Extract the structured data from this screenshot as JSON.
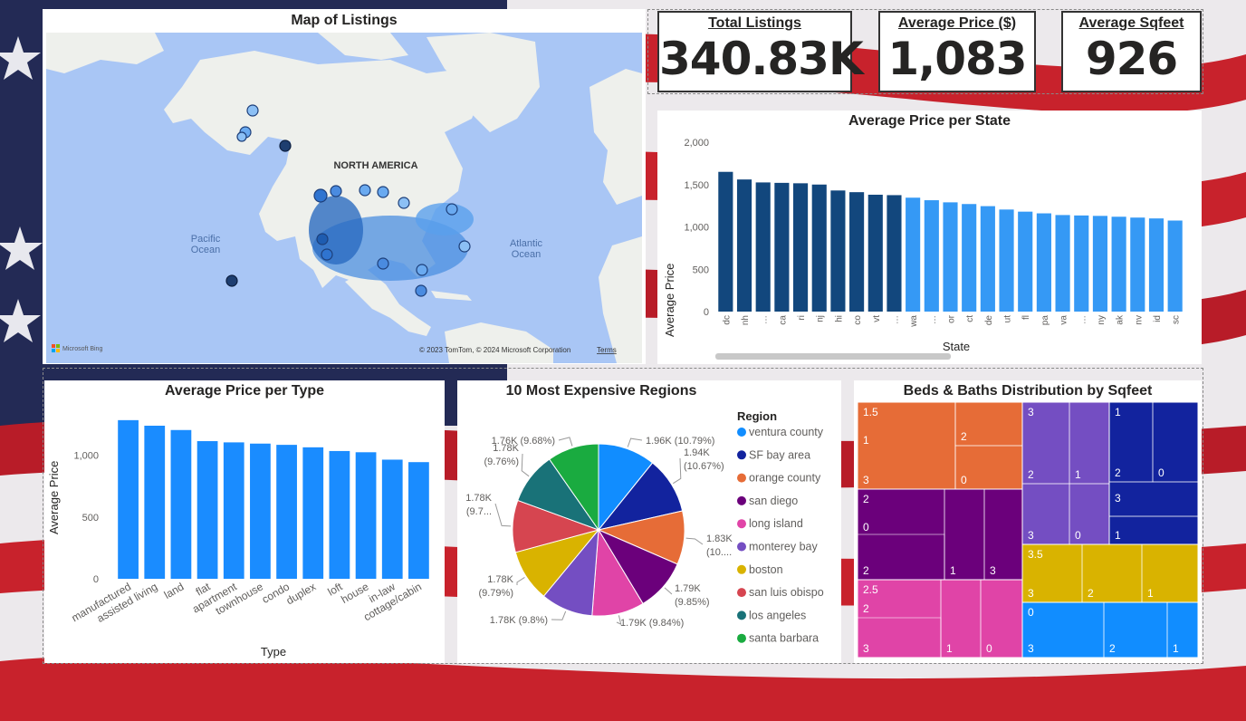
{
  "colors": {
    "dark_blue": "#12477d",
    "light_blue": "#3599f5",
    "type_blue": "#1a8cff",
    "flag_red": "#c8222c",
    "flag_navy": "#1e2448"
  },
  "map": {
    "title": "Map of Listings",
    "labels": {
      "continent": "NORTH AMERICA",
      "pacific_1": "Pacific",
      "pacific_2": "Ocean",
      "atlantic_1": "Atlantic",
      "atlantic_2": "Ocean"
    },
    "attribution": "© 2023 TomTom, © 2024 Microsoft Corporation",
    "terms": "Terms",
    "bing_logo": "Microsoft Bing"
  },
  "kpis": [
    {
      "label": "Total Listings",
      "value": "340.83K"
    },
    {
      "label": "Average Price ($)",
      "value": "1,083"
    },
    {
      "label": "Average Sqfeet",
      "value": "926"
    }
  ],
  "state_chart": {
    "title": "Average Price per State",
    "xlabel": "State",
    "ylabel": "Average Price",
    "chart_data": {
      "type": "bar",
      "categories": [
        "dc",
        "nh",
        "…",
        "ca",
        "ri",
        "nj",
        "hi",
        "co",
        "vt",
        "…",
        "wa",
        "…",
        "or",
        "ct",
        "de",
        "ut",
        "fl",
        "pa",
        "va",
        "…",
        "ny",
        "ak",
        "nv",
        "id",
        "sc"
      ],
      "values": [
        1650,
        1560,
        1525,
        1520,
        1515,
        1500,
        1430,
        1410,
        1380,
        1375,
        1345,
        1315,
        1290,
        1270,
        1245,
        1205,
        1180,
        1160,
        1140,
        1135,
        1130,
        1120,
        1110,
        1100,
        1075
      ],
      "dark_count": 10,
      "ylim": [
        0,
        2000
      ],
      "yticks": [
        0,
        500,
        1000,
        1500,
        2000
      ],
      "ytick_labels": [
        "0",
        "500",
        "1,000",
        "1,500",
        "2,000"
      ]
    }
  },
  "type_chart": {
    "title": "Average Price per Type",
    "xlabel": "Type",
    "ylabel": "Average Price",
    "chart_data": {
      "type": "bar",
      "categories": [
        "manufactured",
        "assisted living",
        "land",
        "flat",
        "apartment",
        "townhouse",
        "condo",
        "duplex",
        "loft",
        "house",
        "in-law",
        "cottage/cabin"
      ],
      "values": [
        1285,
        1240,
        1205,
        1115,
        1105,
        1095,
        1085,
        1065,
        1035,
        1025,
        965,
        945
      ],
      "ylim": [
        0,
        1350
      ],
      "yticks": [
        0,
        500,
        1000
      ],
      "ytick_labels": [
        "0",
        "500",
        "1,000"
      ]
    }
  },
  "pie_chart": {
    "title": "10 Most Expensive Regions",
    "legend_title": "Region",
    "chart_data": {
      "type": "pie",
      "slices": [
        {
          "name": "ventura county",
          "value": 1.96,
          "percent": 10.79,
          "color": "#118dff",
          "label_lines": [
            "1.96K (10.79%)"
          ]
        },
        {
          "name": "SF bay area",
          "value": 1.94,
          "percent": 10.67,
          "color": "#12239e",
          "label_lines": [
            "1.94K",
            "(10.67%)"
          ]
        },
        {
          "name": "orange county",
          "value": 1.83,
          "percent": 10.07,
          "color": "#e66c37",
          "label_lines": [
            "1.83K",
            "(10...."
          ]
        },
        {
          "name": "san diego",
          "value": 1.79,
          "percent": 9.85,
          "color": "#6b007b",
          "label_lines": [
            "1.79K",
            "(9.85%)"
          ]
        },
        {
          "name": "long island",
          "value": 1.79,
          "percent": 9.84,
          "color": "#e044a7",
          "label_lines": [
            "1.79K (9.84%)"
          ]
        },
        {
          "name": "monterey bay",
          "value": 1.78,
          "percent": 9.8,
          "color": "#744ec2",
          "label_lines": [
            "1.78K (9.8%)"
          ]
        },
        {
          "name": "boston",
          "value": 1.78,
          "percent": 9.79,
          "color": "#d9b300",
          "label_lines": [
            "1.78K",
            "(9.79%)"
          ]
        },
        {
          "name": "san luis obispo",
          "value": 1.78,
          "percent": 9.77,
          "color": "#d64550",
          "label_lines": [
            "1.78K",
            "(9.7..."
          ]
        },
        {
          "name": "los angeles",
          "value": 1.78,
          "percent": 9.76,
          "color": "#197278",
          "label_lines": [
            "1.78K",
            "(9.76%)"
          ]
        },
        {
          "name": "santa barbara",
          "value": 1.76,
          "percent": 9.68,
          "color": "#1aab40",
          "label_lines": [
            "1.76K (9.68%)"
          ]
        }
      ]
    }
  },
  "treemap": {
    "title": "Beds & Baths Distribution by Sqfeet",
    "chart_data": {
      "type": "treemap",
      "groups": [
        {
          "beds": "1.5",
          "color": "#e66c37",
          "cells": [
            {
              "label": "1"
            },
            {
              "label": "3"
            },
            {
              "label": "2"
            },
            {
              "label": "0"
            }
          ]
        },
        {
          "beds": "2",
          "color": "#6b007b",
          "cells": [
            {
              "label": "0"
            },
            {
              "label": "2"
            },
            {
              "label": "1"
            },
            {
              "label": "3"
            }
          ]
        },
        {
          "beds": "2.5",
          "color": "#e044a7",
          "cells": [
            {
              "label": "2"
            },
            {
              "label": "3"
            },
            {
              "label": "1"
            },
            {
              "label": "0"
            }
          ]
        },
        {
          "beds": "3",
          "color": "#744ec2",
          "cells": [
            {
              "label": "2"
            },
            {
              "label": "1"
            },
            {
              "label": "3"
            },
            {
              "label": "0"
            }
          ]
        },
        {
          "beds": "1",
          "color": "#12239e",
          "cells": [
            {
              "label": "2"
            },
            {
              "label": "0"
            },
            {
              "label": "3"
            },
            {
              "label": "1"
            }
          ]
        },
        {
          "beds": "3.5",
          "color": "#d9b300",
          "cells": [
            {
              "label": "3"
            },
            {
              "label": "2"
            },
            {
              "label": "1"
            }
          ]
        },
        {
          "beds": "0",
          "color": "#118dff",
          "cells": [
            {
              "label": "3"
            },
            {
              "label": "2"
            },
            {
              "label": "1"
            }
          ]
        }
      ]
    }
  }
}
